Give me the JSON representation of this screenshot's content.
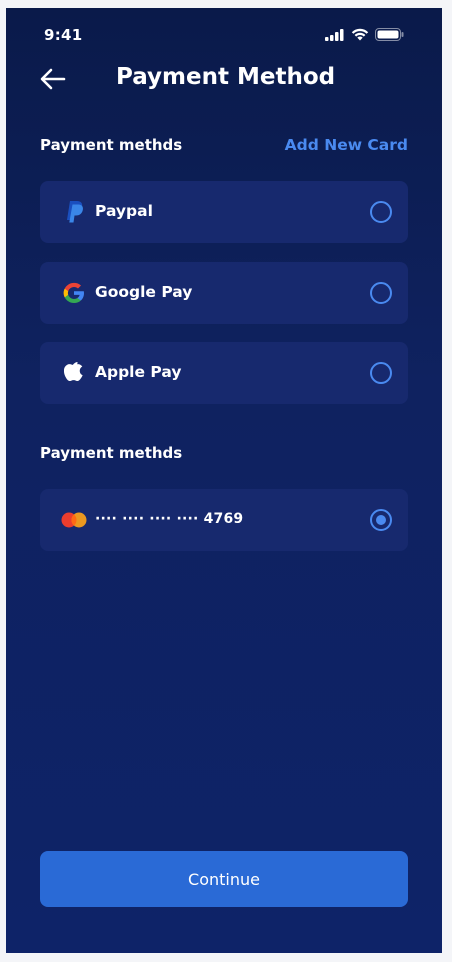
{
  "status_bar": {
    "time": "9:41"
  },
  "header": {
    "title": "Payment Method"
  },
  "section_methods": {
    "label": "Payment methds",
    "add_card_label": "Add New Card",
    "options": [
      {
        "label": "Paypal",
        "icon": "paypal-icon",
        "selected": false
      },
      {
        "label": "Google Pay",
        "icon": "google-icon",
        "selected": false
      },
      {
        "label": "Apple Pay",
        "icon": "apple-icon",
        "selected": false
      }
    ]
  },
  "section_cards": {
    "label": "Payment methds",
    "cards": [
      {
        "number": "···· ···· ···· ···· 4769",
        "icon": "mastercard-icon",
        "selected": true
      }
    ]
  },
  "continue_label": "Continue",
  "colors": {
    "background_top": "#0a1a4a",
    "background_bottom": "#0e2368",
    "card_bg": "#17296e",
    "accent": "#4a8af0",
    "button": "#2a6ad6"
  }
}
